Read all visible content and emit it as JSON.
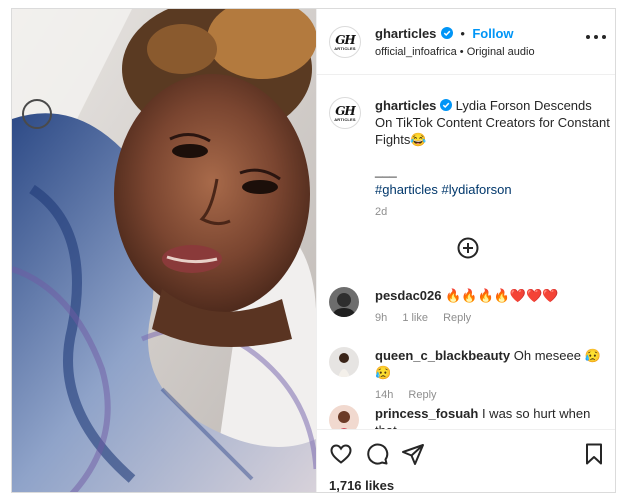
{
  "post": {
    "username": "gharticles",
    "follow_label": "Follow",
    "separator": "•",
    "audio_owner": "official_infoafrica",
    "audio_label": "Original audio",
    "logo_text": "GH",
    "logo_subtext": "ARTICLES"
  },
  "caption": {
    "username": "gharticles",
    "text": "Lydia Forson Descends On TikTok Content Creators for Constant Fights😂",
    "divider": "___",
    "hashtags": "#gharticles #lydiaforson",
    "age": "2d"
  },
  "comments": [
    {
      "username": "pesdac026",
      "text": "🔥🔥🔥🔥❤️❤️❤️",
      "age": "9h",
      "likes": "1 like",
      "reply_label": "Reply"
    },
    {
      "username": "queen_c_blackbeauty",
      "text": "Oh meseee 😥😥",
      "age": "14h",
      "reply_label": "Reply"
    },
    {
      "username": "princess_fosuah",
      "text": "I was so hurt when that"
    }
  ],
  "footer": {
    "likes": "1,716 likes"
  },
  "colors": {
    "accent": "#0095f6",
    "verified": "#0095f6",
    "border": "#dbdbdb",
    "muted": "#8e8e8e"
  }
}
